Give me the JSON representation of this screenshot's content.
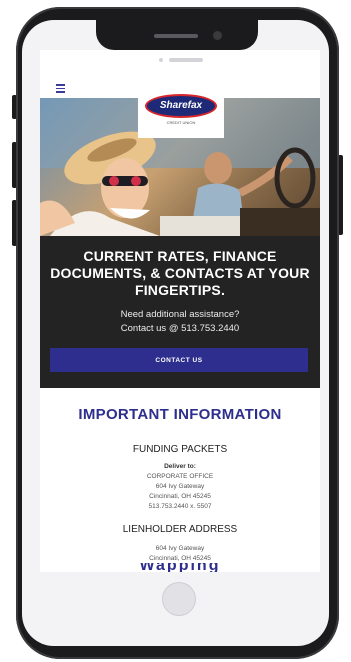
{
  "logo": {
    "name": "Sharefax",
    "tagline": "CREDIT UNION"
  },
  "hero": {
    "headline": "CURRENT RATES, FINANCE DOCUMENTS, & CONTACTS AT YOUR FINGERTIPS.",
    "assist_line1": "Need additional assistance?",
    "assist_line2": "Contact us @ 513.753.2440",
    "cta_label": "CONTACT US"
  },
  "info": {
    "title": "IMPORTANT INFORMATION",
    "funding": {
      "heading": "FUNDING PACKETS",
      "deliver_label": "Deliver to:",
      "lines": [
        "CORPORATE OFFICE",
        "604 Ivy Gateway",
        "Cincinnati, OH 45245",
        "513.753.2440 x. 5507"
      ]
    },
    "lienholder": {
      "heading": "LIENHOLDER ADDRESS",
      "lines": [
        "604 Ivy Gateway",
        "Cincinnati, OH 45245"
      ]
    },
    "next_heading_peek": "Wapping"
  },
  "colors": {
    "brand_blue": "#2e2e8e",
    "dark_band": "#232323",
    "logo_red": "#d8262a"
  }
}
